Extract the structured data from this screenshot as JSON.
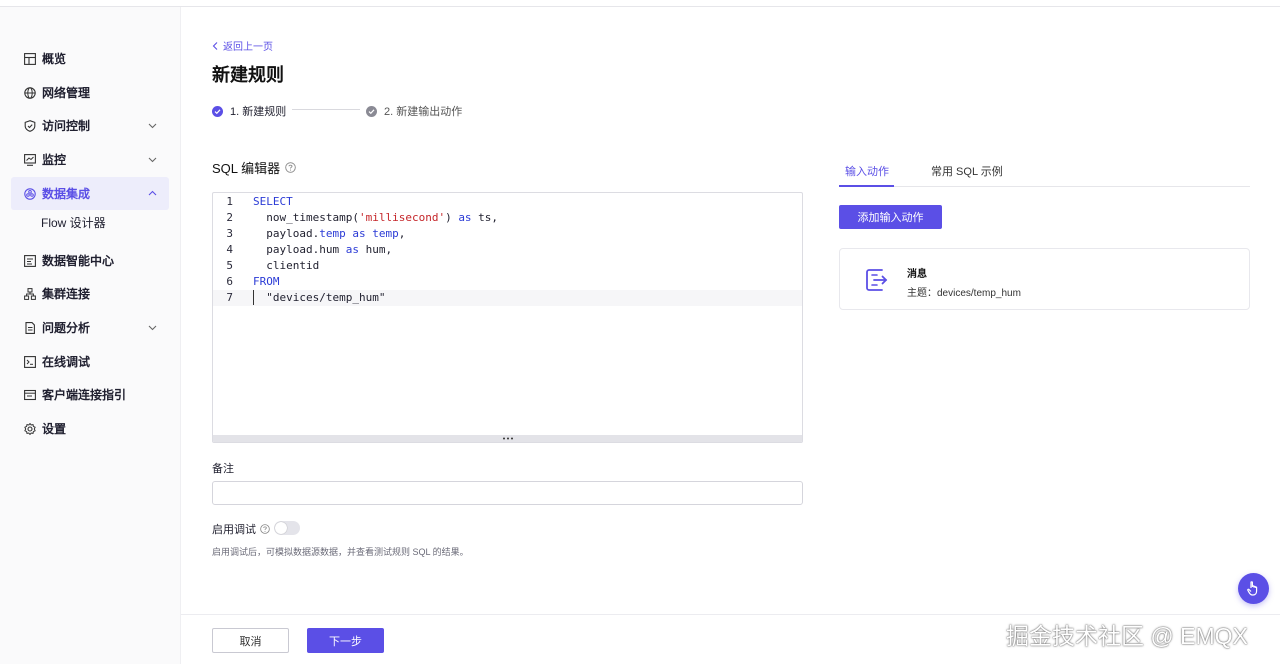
{
  "sidebar": {
    "items": [
      {
        "label": "概览",
        "icon": "dashboard-icon"
      },
      {
        "label": "网络管理",
        "icon": "globe-icon"
      },
      {
        "label": "访问控制",
        "icon": "shield-icon",
        "has_children": true
      },
      {
        "label": "监控",
        "icon": "monitor-icon",
        "has_children": true
      },
      {
        "label": "数据集成",
        "icon": "integration-icon",
        "has_children": true,
        "active": true,
        "expanded": true
      },
      {
        "label": "数据智能中心",
        "icon": "data-center-icon"
      },
      {
        "label": "集群连接",
        "icon": "cluster-icon"
      },
      {
        "label": "问题分析",
        "icon": "analysis-icon",
        "has_children": true
      },
      {
        "label": "在线调试",
        "icon": "debug-icon"
      },
      {
        "label": "客户端连接指引",
        "icon": "guide-icon"
      },
      {
        "label": "设置",
        "icon": "gear-icon"
      }
    ],
    "sub_item": "Flow 设计器"
  },
  "header": {
    "back": "返回上一页",
    "title": "新建规则"
  },
  "steps": [
    {
      "label": "1. 新建规则",
      "status": "active"
    },
    {
      "label": "2. 新建输出动作",
      "status": "pending"
    }
  ],
  "editor": {
    "label": "SQL 编辑器",
    "lines": [
      {
        "n": "1",
        "tokens": [
          {
            "t": "SELECT",
            "c": "kw"
          }
        ]
      },
      {
        "n": "2",
        "tokens": [
          {
            "t": "  now_timestamp(",
            "c": ""
          },
          {
            "t": "'millisecond'",
            "c": "str"
          },
          {
            "t": ") ",
            "c": ""
          },
          {
            "t": "as",
            "c": "kw"
          },
          {
            "t": " ts,",
            "c": ""
          }
        ]
      },
      {
        "n": "3",
        "tokens": [
          {
            "t": "  payload.",
            "c": ""
          },
          {
            "t": "temp",
            "c": "kw"
          },
          {
            "t": " ",
            "c": ""
          },
          {
            "t": "as",
            "c": "kw"
          },
          {
            "t": " ",
            "c": ""
          },
          {
            "t": "temp",
            "c": "kw"
          },
          {
            "t": ",",
            "c": ""
          }
        ]
      },
      {
        "n": "4",
        "tokens": [
          {
            "t": "  payload.hum ",
            "c": ""
          },
          {
            "t": "as",
            "c": "kw"
          },
          {
            "t": " hum,",
            "c": ""
          }
        ]
      },
      {
        "n": "5",
        "tokens": [
          {
            "t": "  clientid",
            "c": ""
          }
        ]
      },
      {
        "n": "6",
        "tokens": [
          {
            "t": "FROM",
            "c": "kw"
          }
        ]
      },
      {
        "n": "7",
        "tokens": [
          {
            "t": "  \"devices/temp_hum\"",
            "c": ""
          }
        ]
      }
    ]
  },
  "note": {
    "label": "备注",
    "value": "",
    "placeholder": ""
  },
  "debug": {
    "label": "启用调试",
    "enabled": false,
    "hint": "启用调试后，可模拟数据源数据，并查看测试规则 SQL 的结果。"
  },
  "right": {
    "tabs": [
      "输入动作",
      "常用 SQL 示例"
    ],
    "active_tab": 0,
    "add_button": "添加输入动作",
    "card": {
      "title": "消息",
      "subtitle": "主题：devices/temp_hum"
    }
  },
  "footer": {
    "cancel": "取消",
    "next": "下一步"
  },
  "watermark": "掘金技术社区 @ EMQX",
  "colors": {
    "accent": "#5b4fe6",
    "keyword": "#2b3bd6",
    "string": "#c5262a"
  }
}
